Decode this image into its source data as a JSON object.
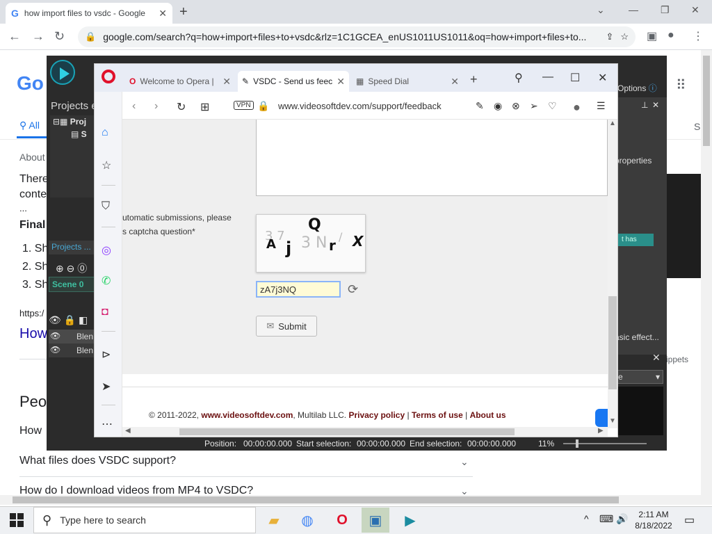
{
  "chrome": {
    "tab_title": "how import files to vsdc - Google",
    "url": "google.com/search?q=how+import+files+to+vsdc&rlz=1C1GCEA_enUS1011US1011&oq=how+import+files+to..."
  },
  "google": {
    "logo": "Go",
    "all_tab": "All",
    "s_tab": "S",
    "about": "About",
    "there": "There",
    "conte": "conte",
    "ellipsis": "...",
    "final": "Final",
    "list": [
      "1. Sh",
      "2. Sh",
      "3. Sh"
    ],
    "https": "https:/",
    "how_link": "How",
    "peo": "Peo",
    "how_q": "How",
    "question1": "What files does VSDC support?",
    "question2": "How do I download videos from MP4 to VSDC?",
    "snippets": "ippets"
  },
  "vsdc": {
    "projects_heading": "Projects e",
    "tree_item": "Proj",
    "tree_sub": "S",
    "projects_tab": "Projects ...",
    "scene": "Scene 0",
    "layer1": "Blen",
    "layer2": "Blen",
    "options": "Options",
    "properties": "properties",
    "has": "t has",
    "basic_effect": "asic effect...",
    "dropdown": "e",
    "status": {
      "position_label": "Position:",
      "position_value": "00:00:00.000",
      "start_label": "Start selection:",
      "start_value": "00:00:00.000",
      "end_label": "End selection:",
      "end_value": "00:00:00.000",
      "zoom": "11%"
    }
  },
  "opera": {
    "tabs": [
      {
        "label": "Welcome to Opera |"
      },
      {
        "label": "VSDC - Send us feec"
      },
      {
        "label": "Speed Dial"
      }
    ],
    "vpn": "VPN",
    "url": "www.videosoftdev.com/support/feedback"
  },
  "page": {
    "note1": "utomatic submissions, please",
    "note2": "s captcha question*",
    "captcha_text": "zA7j3NQ",
    "submit": "Submit",
    "footer": {
      "copyright": "© 2011-2022,",
      "site": "www.videosoftdev.com",
      "company": ", Multilab LLC.",
      "privacy": "Privacy policy",
      "terms": "Terms of use",
      "about": "About us"
    }
  },
  "taskbar": {
    "search_placeholder": "Type here to search",
    "time": "2:11 AM",
    "date": "8/18/2022"
  }
}
